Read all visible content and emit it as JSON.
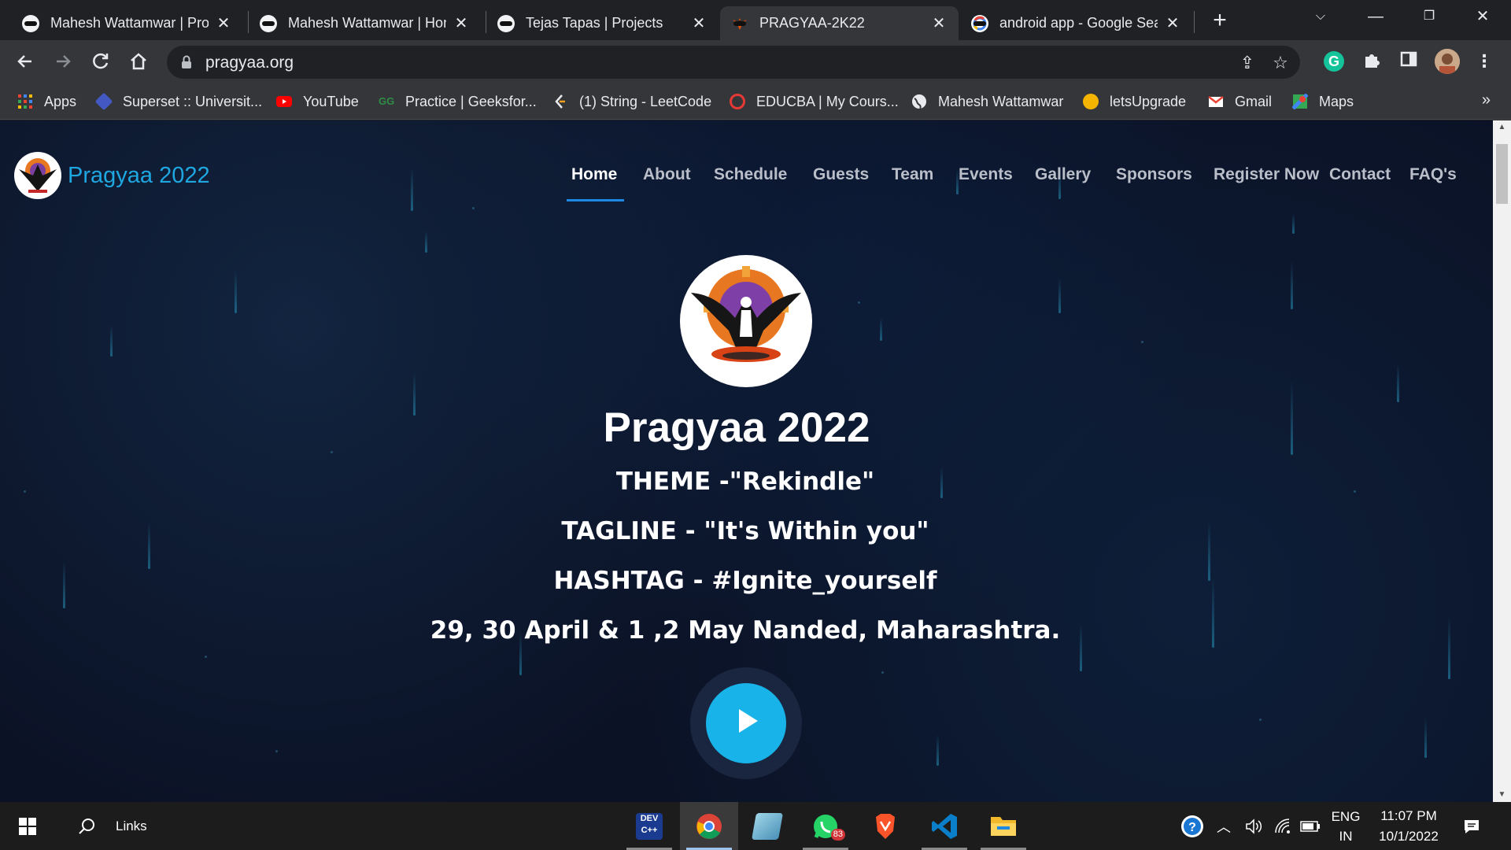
{
  "browser": {
    "tabs": [
      {
        "title": "Mahesh Wattamwar | Proj",
        "active": false
      },
      {
        "title": "Mahesh Wattamwar | Hon",
        "active": false
      },
      {
        "title": "Tejas Tapas | Projects",
        "active": false
      },
      {
        "title": "PRAGYAA-2K22",
        "active": true
      },
      {
        "title": "android app - Google Sea",
        "active": false
      }
    ],
    "new_tab": "+",
    "url": "pragyaa.org",
    "bookmarks": [
      {
        "label": "Apps",
        "icon": "apps-grid-icon"
      },
      {
        "label": "Superset :: Universit...",
        "icon": "superset-icon"
      },
      {
        "label": "YouTube",
        "icon": "youtube-icon"
      },
      {
        "label": "Practice | Geeksfor...",
        "icon": "geeksforgeeks-icon"
      },
      {
        "label": "(1) String - LeetCode",
        "icon": "leetcode-icon"
      },
      {
        "label": "EDUCBA | My Cours...",
        "icon": "educba-icon"
      },
      {
        "label": "Mahesh Wattamwar",
        "icon": "globe-icon"
      },
      {
        "label": "letsUpgrade",
        "icon": "letsupgrade-icon"
      },
      {
        "label": "Gmail",
        "icon": "gmail-icon"
      },
      {
        "label": "Maps",
        "icon": "maps-icon"
      }
    ],
    "bookmarks_more": "»"
  },
  "site": {
    "brand": "Pragyaa 2022",
    "nav": [
      "Home",
      "About",
      "Schedule",
      "Guests",
      "Team",
      "Events",
      "Gallery",
      "Sponsors",
      "Register Now",
      "Contact",
      "FAQ's"
    ],
    "active_nav": "Home",
    "hero": {
      "title": "Pragyaa 2022",
      "theme": "THEME -\"Rekindle\"",
      "tagline": "TAGLINE - \"It's Within you\"",
      "hashtag": "HASHTAG - #Ignite_yourself",
      "dates": "29, 30 April & 1 ,2 May Nanded, Maharashtra."
    }
  },
  "taskbar": {
    "search_label": "Links",
    "whatsapp_badge": "83",
    "language": "ENG",
    "region": "IN",
    "time": "11:07 PM",
    "date": "10/1/2022"
  },
  "colors": {
    "accent": "#1ea7e1",
    "page_bg": "#0b1226",
    "nav_underline": "#1e88e5",
    "play": "#18b3e8"
  }
}
